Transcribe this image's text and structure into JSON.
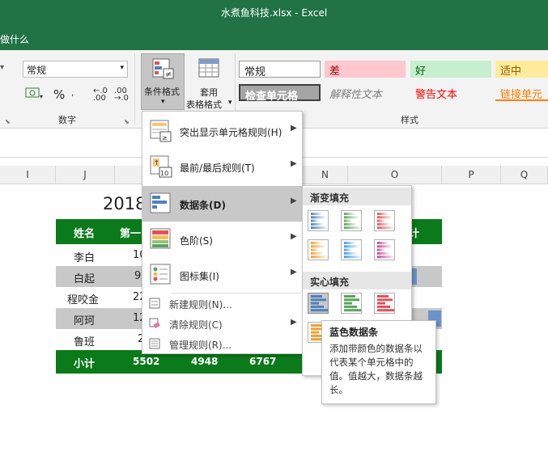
{
  "window": {
    "title": "水煮鱼科技.xlsx  -  Excel",
    "tell_me": "做什么"
  },
  "ribbon": {
    "number_format": "常规",
    "percent": "%",
    "number_group": "数字",
    "styles_group": "样式",
    "cond_format": {
      "line1": "条件格式"
    },
    "table_format": {
      "line1": "套用",
      "line2": "表格格式"
    },
    "styles": {
      "normal": "常规",
      "bad": "差",
      "good": "好",
      "neutral": "适中",
      "check_cell": "检查单元格",
      "explanatory": "解释性文本",
      "warning": "警告文本",
      "linked": "链接单元"
    }
  },
  "columns": [
    "I",
    "J",
    "N",
    "O",
    "P",
    "Q"
  ],
  "sheet": {
    "title_partial": "2018",
    "header": {
      "name": "姓名",
      "first": "第一",
      "total": "计"
    },
    "rows": [
      {
        "name": "李白",
        "val": "10"
      },
      {
        "name": "白起",
        "val": "9"
      },
      {
        "name": "程咬金",
        "val": "22"
      },
      {
        "name": "阿珂",
        "val": "12"
      },
      {
        "name": "鲁班",
        "val": "2"
      }
    ],
    "subtotal": {
      "label": "小计",
      "v1": "5502",
      "v2": "4948",
      "v3": "6767"
    }
  },
  "menu": {
    "items": [
      {
        "label": "突出显示单元格规则(H)",
        "icon": "highlight-rules-icon"
      },
      {
        "label": "最前/最后规则(T)",
        "icon": "top-bottom-rules-icon",
        "badge": "10"
      },
      {
        "label": "数据条(D)",
        "icon": "data-bars-icon"
      },
      {
        "label": "色阶(S)",
        "icon": "color-scales-icon"
      },
      {
        "label": "图标集(I)",
        "icon": "icon-sets-icon"
      }
    ],
    "small": [
      {
        "label": "新建规则(N)...",
        "icon": "new-rule-icon"
      },
      {
        "label": "清除规则(C)",
        "icon": "clear-rules-icon"
      },
      {
        "label": "管理规则(R)...",
        "icon": "manage-rules-icon"
      }
    ]
  },
  "submenu": {
    "gradient": "渐变填充",
    "solid": "实心填充",
    "colors": [
      "#4f81bd",
      "#5ba45b",
      "#e0525a",
      "#f0a030",
      "#3d9ae0",
      "#b94a9a"
    ]
  },
  "tooltip": {
    "title": "蓝色数据条",
    "body": "添加带颜色的数据条以代表某个单元格中的值。值越大，数据条越长。"
  }
}
